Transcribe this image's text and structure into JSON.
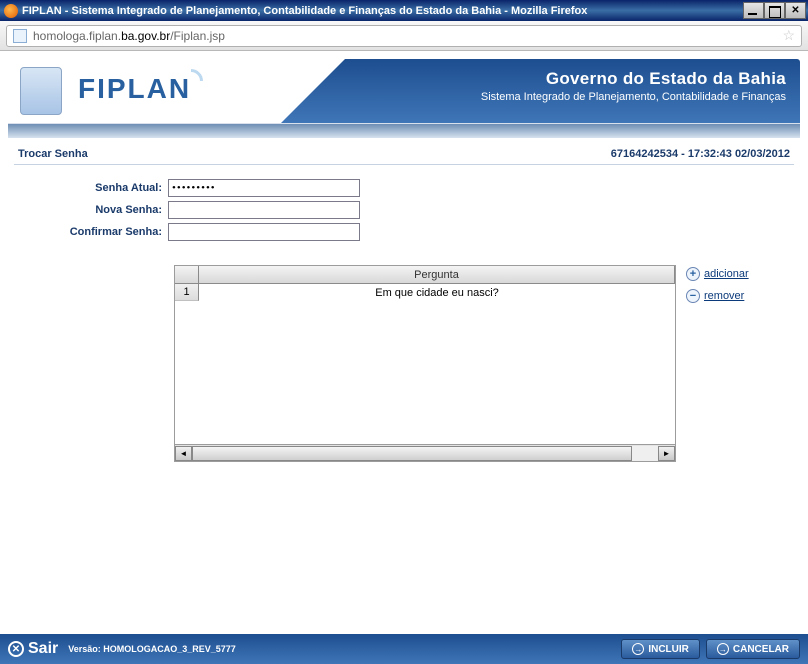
{
  "window": {
    "title": "FIPLAN - Sistema Integrado de Planejamento, Contabilidade e Finanças do Estado da Bahia - Mozilla Firefox"
  },
  "address": {
    "url_pre": "homologa.fiplan.",
    "url_bold": "ba.gov.br",
    "url_post": "/Fiplan.jsp"
  },
  "header": {
    "logo_text": "FIPLAN",
    "gov_title": "Governo do Estado da Bahia",
    "gov_sub": "Sistema Integrado de Planejamento, Contabilidade e Finanças"
  },
  "panel": {
    "title": "Trocar Senha",
    "meta": "67164242534 - 17:32:43 02/03/2012"
  },
  "form": {
    "current_label": "Senha Atual:",
    "current_value": "•••••••••",
    "new_label": "Nova Senha:",
    "new_value": "",
    "confirm_label": "Confirmar Senha:",
    "confirm_value": ""
  },
  "grid": {
    "header_question": "Pergunta",
    "rows": [
      {
        "num": "1",
        "text": "Em que cidade eu nasci?"
      }
    ]
  },
  "links": {
    "add": "adicionar",
    "remove": "remover"
  },
  "footer": {
    "sair": "Sair",
    "version": "Versão: HOMOLOGACAO_3_REV_5777",
    "include": "INCLUIR",
    "cancel": "CANCELAR"
  }
}
